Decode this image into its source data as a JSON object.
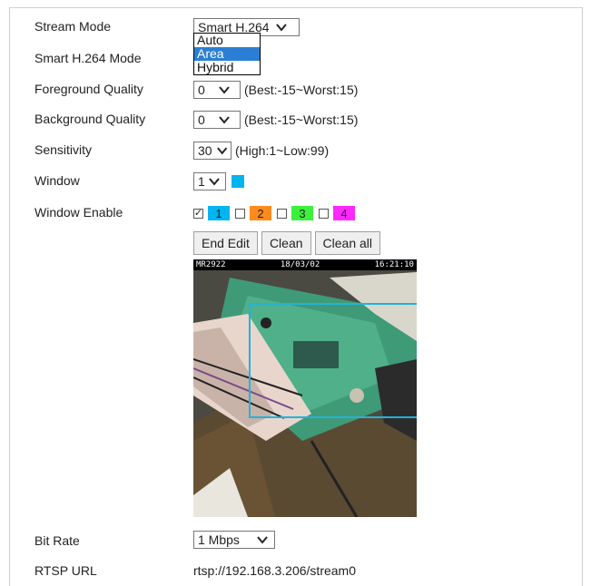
{
  "fields": {
    "stream_mode": {
      "label": "Stream Mode",
      "value": "Smart H.264"
    },
    "smart_mode": {
      "label": "Smart H.264 Mode",
      "options": [
        "Auto",
        "Area",
        "Hybrid"
      ],
      "selected": "Area"
    },
    "foreground_quality": {
      "label": "Foreground Quality",
      "value": "0",
      "hint": "(Best:-15~Worst:15)"
    },
    "background_quality": {
      "label": "Background Quality",
      "value": "0",
      "hint": "(Best:-15~Worst:15)"
    },
    "sensitivity": {
      "label": "Sensitivity",
      "value": "30",
      "hint": "(High:1~Low:99)"
    },
    "window": {
      "label": "Window",
      "value": "1",
      "color": "#00b4f0"
    },
    "window_enable": {
      "label": "Window Enable",
      "items": [
        {
          "num": "1",
          "checked": true,
          "color": "#00b4f0"
        },
        {
          "num": "2",
          "checked": false,
          "color": "#ff8a1e"
        },
        {
          "num": "3",
          "checked": false,
          "color": "#3cf03c"
        },
        {
          "num": "4",
          "checked": false,
          "color": "#ff28ff"
        }
      ]
    },
    "buttons": {
      "end_edit": "End Edit",
      "clean": "Clean",
      "clean_all": "Clean all"
    },
    "video_osd": {
      "camera": "MR2922",
      "date": "18/03/02",
      "time": "16:21:10"
    },
    "bit_rate": {
      "label": "Bit Rate",
      "value": "1 Mbps"
    },
    "rtsp_url": {
      "label": "RTSP URL",
      "value": "rtsp://192.168.3.206/stream0"
    }
  }
}
